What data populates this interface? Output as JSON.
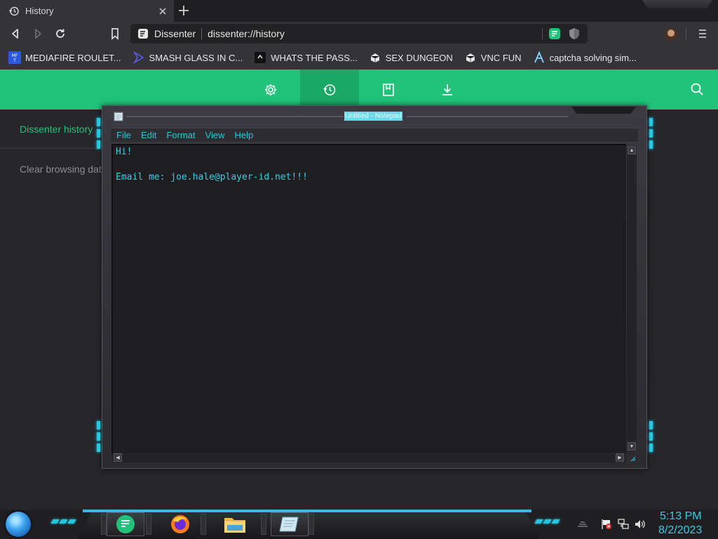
{
  "browser": {
    "tab": {
      "title": "History"
    },
    "address_bar": {
      "site_name": "Dissenter",
      "url": "dissenter://history"
    },
    "bookmarks": [
      {
        "label": "MEDIAFIRE ROULET...",
        "icon": "mediafire-icon"
      },
      {
        "label": "SMASH GLASS IN C...",
        "icon": "chevron-icon"
      },
      {
        "label": "WHATS THE PASS...",
        "icon": "terminal-icon"
      },
      {
        "label": "SEX DUNGEON",
        "icon": "puzzle-icon"
      },
      {
        "label": "VNC FUN",
        "icon": "puzzle-icon"
      },
      {
        "label": "captcha solving sim...",
        "icon": "lambda-icon"
      }
    ]
  },
  "dissenter": {
    "accent_color": "#21c37b",
    "sidebar": {
      "history_label": "Dissenter history",
      "clear_label": "Clear browsing data"
    }
  },
  "notepad": {
    "title": "Untitled - Notepad",
    "menu": [
      "File",
      "Edit",
      "Format",
      "View",
      "Help"
    ],
    "content": "Hi!\n\nEmail me: joe.hale@player-id.net!!!",
    "text_color": "#31d0e6"
  },
  "taskbar": {
    "time": "5:13 PM",
    "date": "8/2/2023"
  }
}
